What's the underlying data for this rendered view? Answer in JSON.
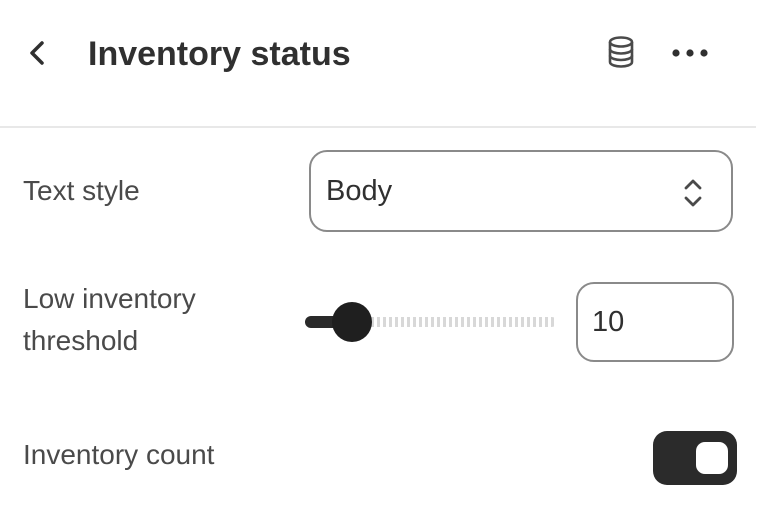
{
  "header": {
    "title": "Inventory status",
    "back_icon": "chevron-left-icon",
    "database_icon": "database-icon",
    "more_icon": "ellipsis-icon"
  },
  "settings": {
    "text_style": {
      "label": "Text style",
      "selected": "Body"
    },
    "low_inventory_threshold": {
      "label_line1": "Low inventory",
      "label_line2": "threshold",
      "value": "10",
      "slider_fraction": 0.17
    },
    "inventory_count": {
      "label": "Inventory count",
      "enabled": true
    }
  },
  "colors": {
    "text": "#303030",
    "control_dark": "#2b2b2b",
    "border": "#8a8a8a"
  }
}
